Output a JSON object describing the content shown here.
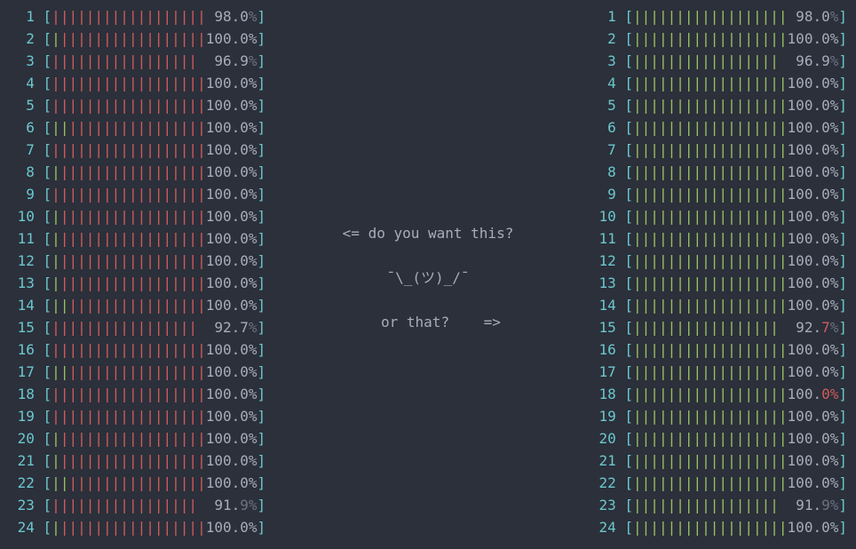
{
  "colors": {
    "bg": "#2b303b",
    "cyan": "#6cc7cc",
    "red": "#d15b5b",
    "green": "#9ac05e",
    "grey": "#a7adba",
    "dim": "#6b7280"
  },
  "left_panel": {
    "bar_color": "red",
    "bar_segments": 18,
    "cores": [
      {
        "n": 1,
        "fill": 18,
        "pct_pre": "98.0",
        "pct_dim": "%",
        "green_lead": 0
      },
      {
        "n": 2,
        "fill": 18,
        "pct_pre": "100.0%",
        "pct_dim": "",
        "green_lead": 1
      },
      {
        "n": 3,
        "fill": 17,
        "pct_pre": "96.9",
        "pct_dim": "%",
        "green_lead": 0
      },
      {
        "n": 4,
        "fill": 18,
        "pct_pre": "100.0%",
        "pct_dim": "",
        "green_lead": 0
      },
      {
        "n": 5,
        "fill": 18,
        "pct_pre": "100.0%",
        "pct_dim": "",
        "green_lead": 0
      },
      {
        "n": 6,
        "fill": 18,
        "pct_pre": "100.0%",
        "pct_dim": "",
        "green_lead": 2
      },
      {
        "n": 7,
        "fill": 18,
        "pct_pre": "100.0%",
        "pct_dim": "",
        "green_lead": 0
      },
      {
        "n": 8,
        "fill": 18,
        "pct_pre": "100.0%",
        "pct_dim": "",
        "green_lead": 1
      },
      {
        "n": 9,
        "fill": 18,
        "pct_pre": "100.0%",
        "pct_dim": "",
        "green_lead": 0
      },
      {
        "n": 10,
        "fill": 18,
        "pct_pre": "100.0%",
        "pct_dim": "",
        "green_lead": 1
      },
      {
        "n": 11,
        "fill": 18,
        "pct_pre": "100.0%",
        "pct_dim": "",
        "green_lead": 1
      },
      {
        "n": 12,
        "fill": 18,
        "pct_pre": "100.0%",
        "pct_dim": "",
        "green_lead": 1
      },
      {
        "n": 13,
        "fill": 18,
        "pct_pre": "100.0%",
        "pct_dim": "",
        "green_lead": 1
      },
      {
        "n": 14,
        "fill": 18,
        "pct_pre": "100.0%",
        "pct_dim": "",
        "green_lead": 2
      },
      {
        "n": 15,
        "fill": 17,
        "pct_pre": "92.7",
        "pct_dim": "%",
        "green_lead": 0
      },
      {
        "n": 16,
        "fill": 18,
        "pct_pre": "100.0%",
        "pct_dim": "",
        "green_lead": 0
      },
      {
        "n": 17,
        "fill": 18,
        "pct_pre": "100.0%",
        "pct_dim": "",
        "green_lead": 2
      },
      {
        "n": 18,
        "fill": 18,
        "pct_pre": "100.0%",
        "pct_dim": "",
        "green_lead": 0
      },
      {
        "n": 19,
        "fill": 18,
        "pct_pre": "100.0%",
        "pct_dim": "",
        "green_lead": 0
      },
      {
        "n": 20,
        "fill": 18,
        "pct_pre": "100.0%",
        "pct_dim": "",
        "green_lead": 1
      },
      {
        "n": 21,
        "fill": 18,
        "pct_pre": "100.0%",
        "pct_dim": "",
        "green_lead": 1
      },
      {
        "n": 22,
        "fill": 18,
        "pct_pre": "100.0%",
        "pct_dim": "",
        "green_lead": 2
      },
      {
        "n": 23,
        "fill": 17,
        "pct_pre": "91.",
        "pct_dim": "9%",
        "green_lead": 0
      },
      {
        "n": 24,
        "fill": 18,
        "pct_pre": "100.0%",
        "pct_dim": "",
        "green_lead": 1
      }
    ]
  },
  "right_panel": {
    "bar_color": "green",
    "bar_segments": 18,
    "cores": [
      {
        "n": 1,
        "fill": 18,
        "pct_pre": "98.0",
        "pct_dim": "%",
        "red_lead": 0
      },
      {
        "n": 2,
        "fill": 18,
        "pct_pre": "100.0%",
        "pct_dim": "",
        "red_lead": 0
      },
      {
        "n": 3,
        "fill": 17,
        "pct_pre": "96.9",
        "pct_dim": "%",
        "red_lead": 0
      },
      {
        "n": 4,
        "fill": 18,
        "pct_pre": "100.0%",
        "pct_dim": "",
        "red_lead": 0
      },
      {
        "n": 5,
        "fill": 18,
        "pct_pre": "100.0%",
        "pct_dim": "",
        "red_lead": 0
      },
      {
        "n": 6,
        "fill": 18,
        "pct_pre": "100.0%",
        "pct_dim": "",
        "red_lead": 0
      },
      {
        "n": 7,
        "fill": 18,
        "pct_pre": "100.0%",
        "pct_dim": "",
        "red_lead": 0
      },
      {
        "n": 8,
        "fill": 18,
        "pct_pre": "100.0%",
        "pct_dim": "",
        "red_lead": 0
      },
      {
        "n": 9,
        "fill": 18,
        "pct_pre": "100.0%",
        "pct_dim": "",
        "red_lead": 0
      },
      {
        "n": 10,
        "fill": 18,
        "pct_pre": "100.0%",
        "pct_dim": "",
        "red_lead": 0
      },
      {
        "n": 11,
        "fill": 18,
        "pct_pre": "100.0%",
        "pct_dim": "",
        "red_lead": 0
      },
      {
        "n": 12,
        "fill": 18,
        "pct_pre": "100.0%",
        "pct_dim": "",
        "red_lead": 0
      },
      {
        "n": 13,
        "fill": 18,
        "pct_pre": "100.0%",
        "pct_dim": "",
        "red_lead": 0
      },
      {
        "n": 14,
        "fill": 18,
        "pct_pre": "100.0%",
        "pct_dim": "",
        "red_lead": 0
      },
      {
        "n": 15,
        "fill": 17,
        "pct_pre": "92.",
        "pct_red": "7",
        "pct_dim": "%",
        "red_lead": 0
      },
      {
        "n": 16,
        "fill": 18,
        "pct_pre": "100.0%",
        "pct_dim": "",
        "red_lead": 0
      },
      {
        "n": 17,
        "fill": 18,
        "pct_pre": "100.0%",
        "pct_dim": "",
        "red_lead": 0
      },
      {
        "n": 18,
        "fill": 18,
        "pct_pre": "100.",
        "pct_red": "0%",
        "pct_dim": "",
        "red_lead": 0
      },
      {
        "n": 19,
        "fill": 18,
        "pct_pre": "100.0%",
        "pct_dim": "",
        "red_lead": 0
      },
      {
        "n": 20,
        "fill": 18,
        "pct_pre": "100.0%",
        "pct_dim": "",
        "red_lead": 0
      },
      {
        "n": 21,
        "fill": 18,
        "pct_pre": "100.0%",
        "pct_dim": "",
        "red_lead": 0
      },
      {
        "n": 22,
        "fill": 18,
        "pct_pre": "100.0%",
        "pct_dim": "",
        "red_lead": 0
      },
      {
        "n": 23,
        "fill": 17,
        "pct_pre": "91.",
        "pct_dim": "9%",
        "red_lead": 0
      },
      {
        "n": 24,
        "fill": 18,
        "pct_pre": "100.0%",
        "pct_dim": "",
        "red_lead": 0
      }
    ]
  },
  "center": {
    "line1": "<= do you want this?",
    "line2": "¯\\_(ツ)_/¯",
    "line3": "   or that?    =>"
  }
}
